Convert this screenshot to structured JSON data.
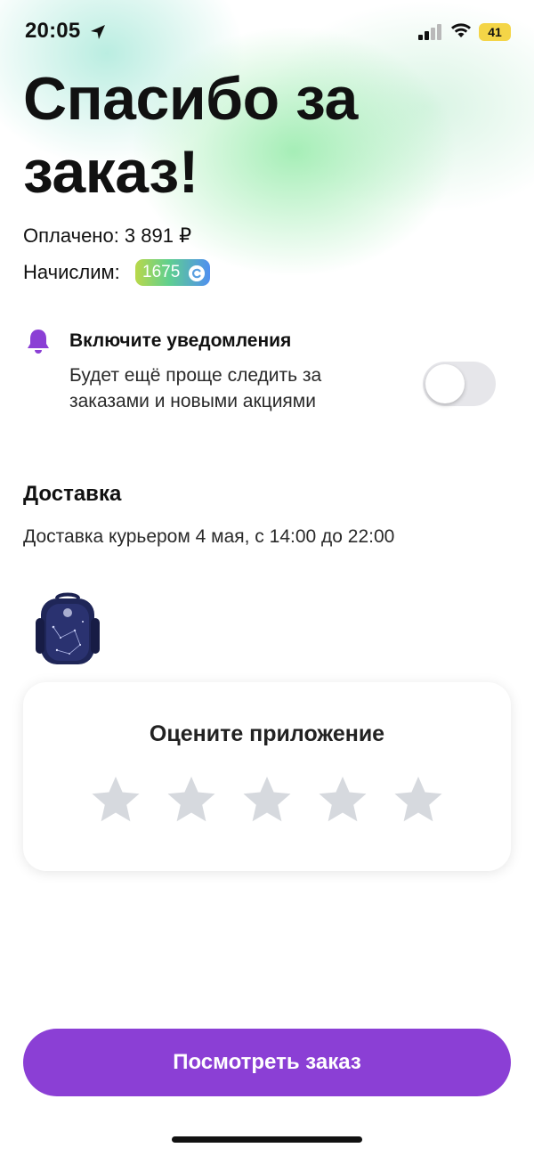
{
  "status_bar": {
    "time": "20:05",
    "battery_level": "41",
    "icons": [
      "location-arrow-icon",
      "signal-icon",
      "wifi-icon",
      "battery-icon"
    ],
    "battery_color": "#f4d547"
  },
  "header": {
    "title": "Спасибо за заказ!"
  },
  "order": {
    "paid_text": "Оплачено: 3 891 ₽",
    "accrue_label": "Начислим:",
    "bonus_points": "1675",
    "bonus_icon": "bonus-coin-icon"
  },
  "notifications": {
    "icon": "bell-icon",
    "title": "Включите уведомления",
    "description": "Будет ещё проще следить за заказами и новыми акциями",
    "toggle_on": false,
    "accent_color": "#8b3fd5"
  },
  "delivery": {
    "heading": "Доставка",
    "details": "Доставка курьером 4 мая, с 14:00 до 22:00",
    "product_image": "school-backpack-image"
  },
  "rating": {
    "title": "Оцените приложение",
    "stars_total": 5,
    "stars_selected": 0,
    "star_color": "#d6d9de"
  },
  "actions": {
    "view_order_label": "Посмотреть заказ",
    "button_color": "#8b3fd5"
  }
}
